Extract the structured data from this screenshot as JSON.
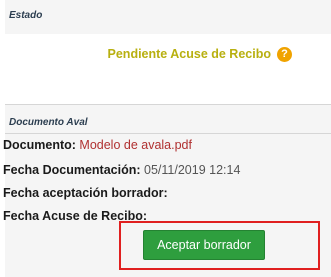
{
  "estado": {
    "title": "Estado",
    "status_text": "Pendiente Acuse de Recibo",
    "help_icon": "question-circle-icon",
    "help_glyph": "?",
    "status_color": "#b8b010"
  },
  "documento_aval": {
    "title": "Documento Aval",
    "documento_label": "Documento:",
    "documento_value": "Modelo de avala.pdf",
    "fecha_doc_label": "Fecha Documentación:",
    "fecha_doc_value": "05/11/2019 12:14",
    "fecha_aceptacion_label": "Fecha aceptación borrador:",
    "fecha_aceptacion_value": "",
    "fecha_acuse_label": "Fecha Acuse de Recibo:",
    "fecha_acuse_value": ""
  },
  "actions": {
    "accept_label": "Aceptar borrador",
    "accept_color": "#2e9e3e",
    "highlight_color": "#e02020"
  }
}
